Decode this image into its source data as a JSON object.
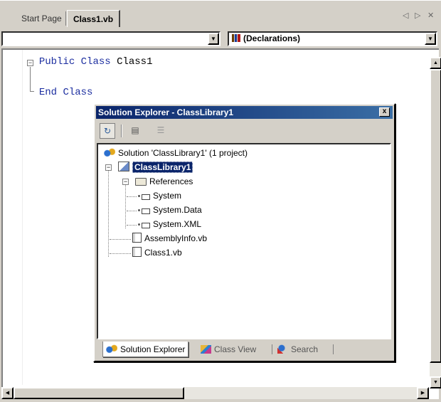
{
  "tabs": {
    "start_page": "Start Page",
    "active": "Class1.vb",
    "nav_prev": "◁",
    "nav_next": "▷",
    "close": "✕"
  },
  "combos": {
    "left_value": "",
    "right_value": "(Declarations)"
  },
  "editor": {
    "line1_kw1": "Public",
    "line1_kw2": "Class",
    "line1_name": "Class1",
    "line2_kw1": "End",
    "line2_kw2": "Class"
  },
  "solution_explorer": {
    "title": "Solution Explorer - ClassLibrary1",
    "close": "x",
    "tree": {
      "solution": "Solution 'ClassLibrary1' (1 project)",
      "project": "ClassLibrary1",
      "references": "References",
      "refs": [
        "System",
        "System.Data",
        "System.XML"
      ],
      "files": [
        "AssemblyInfo.vb",
        "Class1.vb"
      ]
    },
    "bottom_tabs": {
      "solution_explorer": "Solution Explorer",
      "class_view": "Class View",
      "search": "Search"
    }
  },
  "colors": {
    "keyword": "#1c2ea0",
    "title_bar": "#0a246a",
    "selection": "#0a246a"
  }
}
